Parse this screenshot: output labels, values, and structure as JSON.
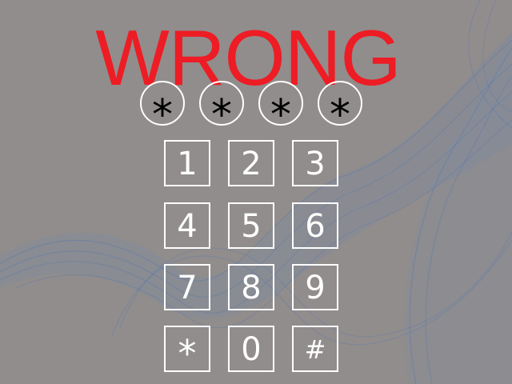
{
  "status": {
    "text": "WRONG",
    "color": "#ee1c24"
  },
  "pin": {
    "slots": [
      "*",
      "*",
      "*",
      "*"
    ]
  },
  "keypad": {
    "keys": [
      "1",
      "2",
      "3",
      "4",
      "5",
      "6",
      "7",
      "8",
      "9",
      "*",
      "0",
      "#"
    ]
  },
  "colors": {
    "background": "#918d8c",
    "key_border": "#ffffff",
    "wave": "#4a7ab8"
  }
}
